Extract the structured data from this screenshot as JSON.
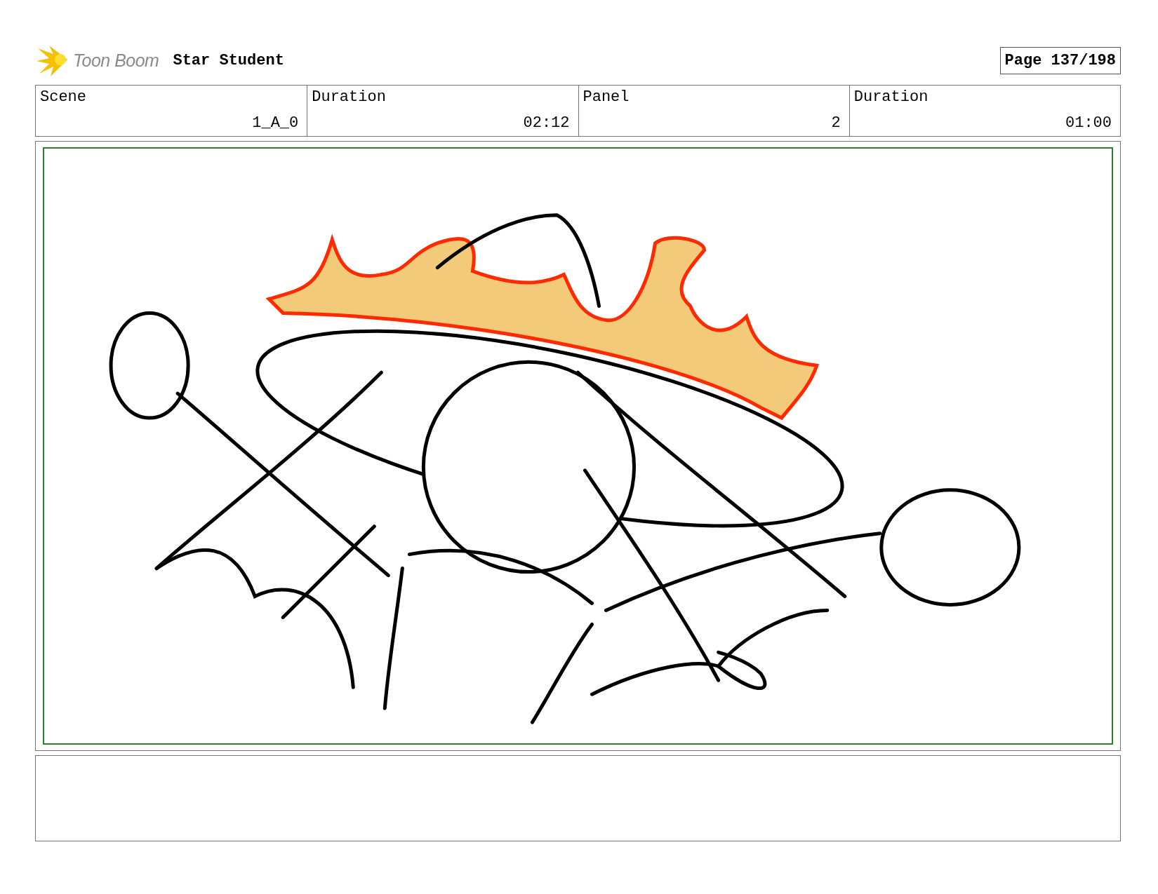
{
  "header": {
    "logo": "Toon Boom",
    "project": "Star Student",
    "page": "Page 137/198"
  },
  "info": [
    {
      "label": "Scene",
      "value": "1_A_0"
    },
    {
      "label": "Duration",
      "value": "02:12"
    },
    {
      "label": "Panel",
      "value": "2"
    },
    {
      "label": "Duration",
      "value": "01:00"
    }
  ]
}
